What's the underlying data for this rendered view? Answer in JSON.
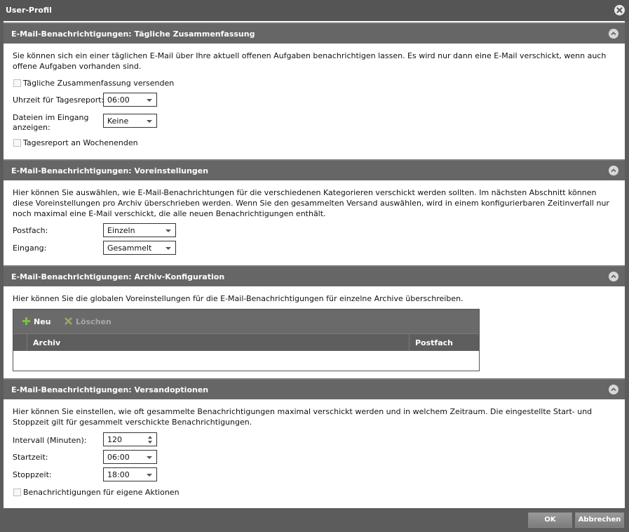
{
  "window": {
    "title": "User-Profil"
  },
  "sections": {
    "daily": {
      "title": "E-Mail-Benachrichtigungen: Tägliche Zusammenfassung",
      "description": "Sie können sich ein einer täglichen E-Mail über Ihre aktuell offenen Aufgaben benachrichtigen lassen. Es wird nur dann eine E-Mail verschickt, wenn auch offene Aufgaben vorhanden sind.",
      "send_summary_label": "Tägliche Zusammenfassung versenden",
      "send_summary_checked": false,
      "time_label": "Uhrzeit für Tagesreport:",
      "time_value": "06:00",
      "files_label": "Dateien im Eingang anzeigen:",
      "files_value": "Keine",
      "weekends_label": "Tagesreport an Wochenenden",
      "weekends_checked": false
    },
    "defaults": {
      "title": "E-Mail-Benachrichtigungen: Voreinstellungen",
      "description": "Hier können Sie auswählen, wie E-Mail-Benachrichtungen für die verschiedenen Kategorieren verschickt werden sollten. Im nächsten Abschnitt können diese Voreinstellungen pro Archiv überschrieben werden. Wenn Sie den gesammelten Versand auswählen, wird in einem konfigurierbaren Zeitinverfall nur noch maximal eine E-Mail verschickt, die alle neuen Benachrichtigungen enthält.",
      "postfach_label": "Postfach:",
      "postfach_value": "Einzeln",
      "eingang_label": "Eingang:",
      "eingang_value": "Gesammelt"
    },
    "archive": {
      "title": "E-Mail-Benachrichtigungen: Archiv-Konfiguration",
      "description": "Hier können Sie die globalen Voreinstellungen für die E-Mail-Benachrichtigungen für einzelne Archive überschreiben.",
      "new_label": "Neu",
      "delete_label": "Löschen",
      "columns": [
        "Archiv",
        "Postfach"
      ],
      "rows": []
    },
    "delivery": {
      "title": "E-Mail-Benachrichtigungen: Versandoptionen",
      "description": "Hier können Sie einstellen, wie oft gesammelte Benachrichtigungen maximal verschickt werden und in welchem Zeitraum. Die eingestellte Start- und Stoppzeit gilt für gesammelt verschickte Benachrichtigungen.",
      "interval_label": "Intervall (Minuten):",
      "interval_value": "120",
      "start_label": "Startzeit:",
      "start_value": "06:00",
      "stop_label": "Stoppzeit:",
      "stop_value": "18:00",
      "own_actions_label": "Benachrichtigungen für eigene Aktionen",
      "own_actions_checked": false
    }
  },
  "footer": {
    "ok_label": "OK",
    "cancel_label": "Abbrechen"
  },
  "colors": {
    "header_bg": "#666666",
    "titlebar_bg": "#555555",
    "add_icon": "#7cc242",
    "delete_icon": "#9aa86a"
  },
  "icons": {
    "close": "close-icon",
    "collapse": "chevron-up-icon",
    "add": "plus-icon",
    "delete": "x-icon"
  }
}
